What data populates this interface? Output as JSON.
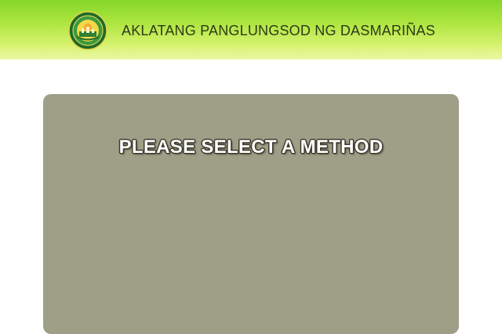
{
  "header": {
    "title": "AKLATANG PANGLUNGSOD NG DASMARIÑAS",
    "logo_icon": "city-seal-icon"
  },
  "panel": {
    "heading": "PLEASE SELECT A METHOD"
  },
  "colors": {
    "header_gradient_top": "#86d62a",
    "header_gradient_bottom": "#ecf7a6",
    "panel_background": "#9f9e86",
    "heading_text": "#ffffff",
    "heading_outline": "#3b3a2c",
    "title_text": "#2f3b16"
  }
}
